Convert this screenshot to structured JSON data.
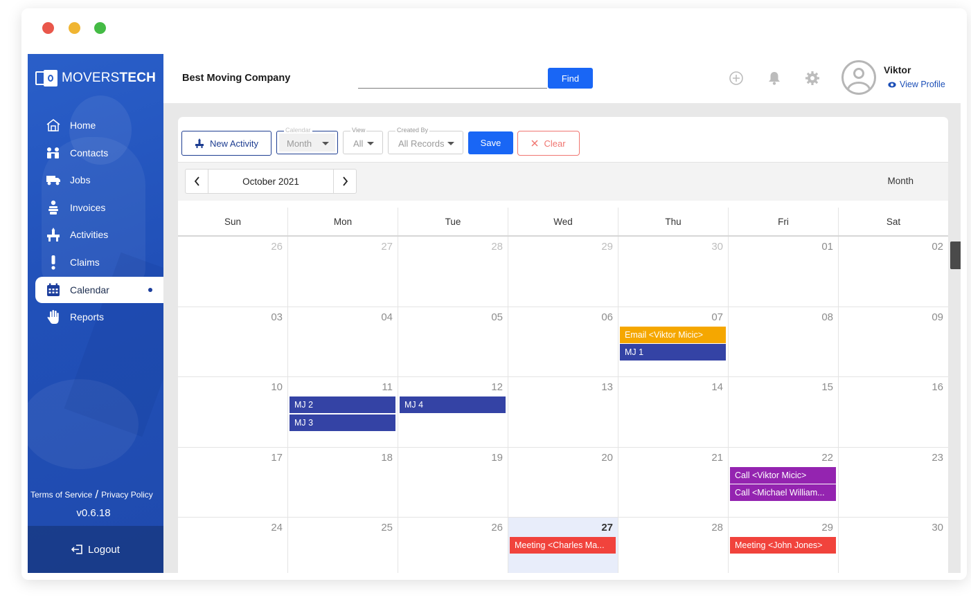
{
  "brand": {
    "name_light": "MOVERS",
    "name_bold": "TECH"
  },
  "sidebar": {
    "items": [
      {
        "label": "Home",
        "icon": "home-icon"
      },
      {
        "label": "Contacts",
        "icon": "contacts-icon"
      },
      {
        "label": "Jobs",
        "icon": "truck-icon"
      },
      {
        "label": "Invoices",
        "icon": "invoice-icon"
      },
      {
        "label": "Activities",
        "icon": "activities-icon"
      },
      {
        "label": "Claims",
        "icon": "exclamation-icon"
      },
      {
        "label": "Calendar",
        "icon": "calendar-icon",
        "active": true
      },
      {
        "label": "Reports",
        "icon": "hand-icon"
      }
    ],
    "terms": "Terms of Service",
    "separator": "/",
    "privacy": "Privacy Policy",
    "version": "v0.6.18",
    "logout": "Logout"
  },
  "header": {
    "company": "Best Moving Company",
    "search_value": "",
    "find_label": "Find",
    "user_name": "Viktor",
    "view_profile": "View Profile"
  },
  "toolbar": {
    "new_activity": "New Activity",
    "calendar_label": "Calendar",
    "calendar_value": "Month",
    "view_label": "View",
    "view_value": "All",
    "created_label": "Created By",
    "created_value": "All Records",
    "save": "Save",
    "clear": "Clear"
  },
  "calendar": {
    "period": "October 2021",
    "mode": "Month",
    "days": [
      "Sun",
      "Mon",
      "Tue",
      "Wed",
      "Thu",
      "Fri",
      "Sat"
    ],
    "weeks": [
      [
        {
          "day": "26",
          "other": true
        },
        {
          "day": "27",
          "other": true
        },
        {
          "day": "28",
          "other": true
        },
        {
          "day": "29",
          "other": true
        },
        {
          "day": "30",
          "other": true
        },
        {
          "day": "01"
        },
        {
          "day": "02"
        }
      ],
      [
        {
          "day": "03"
        },
        {
          "day": "04"
        },
        {
          "day": "05"
        },
        {
          "day": "06"
        },
        {
          "day": "07",
          "events": [
            {
              "text": "Email <Viktor Micic>",
              "color": "#f5a700"
            },
            {
              "text": "MJ 1",
              "color": "#3443a5"
            }
          ]
        },
        {
          "day": "08"
        },
        {
          "day": "09"
        }
      ],
      [
        {
          "day": "10"
        },
        {
          "day": "11",
          "events": [
            {
              "text": "MJ 2",
              "color": "#3443a5"
            },
            {
              "text": "MJ 3",
              "color": "#3443a5"
            }
          ]
        },
        {
          "day": "12",
          "events": [
            {
              "text": "MJ 4",
              "color": "#3443a5"
            }
          ]
        },
        {
          "day": "13"
        },
        {
          "day": "14"
        },
        {
          "day": "15"
        },
        {
          "day": "16"
        }
      ],
      [
        {
          "day": "17"
        },
        {
          "day": "18"
        },
        {
          "day": "19"
        },
        {
          "day": "20"
        },
        {
          "day": "21"
        },
        {
          "day": "22",
          "events": [
            {
              "text": "Call <Viktor Micic>",
              "color": "#9424b0"
            },
            {
              "text": "Call <Michael William...",
              "color": "#9424b0"
            }
          ]
        },
        {
          "day": "23"
        }
      ],
      [
        {
          "day": "24"
        },
        {
          "day": "25"
        },
        {
          "day": "26"
        },
        {
          "day": "27",
          "today": true,
          "events": [
            {
              "text": "Meeting <Charles Ma...",
              "color": "#f1433c"
            }
          ]
        },
        {
          "day": "28"
        },
        {
          "day": "29",
          "events": [
            {
              "text": "Meeting <John Jones>",
              "color": "#f1433c"
            }
          ]
        },
        {
          "day": "30"
        }
      ]
    ]
  },
  "colors": {
    "brand_blue": "#2a5fc9",
    "primary_button": "#1966f5",
    "job_event": "#3443a5",
    "email_event": "#f5a700",
    "call_event": "#9424b0",
    "meeting_event": "#f1433c",
    "clear_red": "#f07570"
  }
}
